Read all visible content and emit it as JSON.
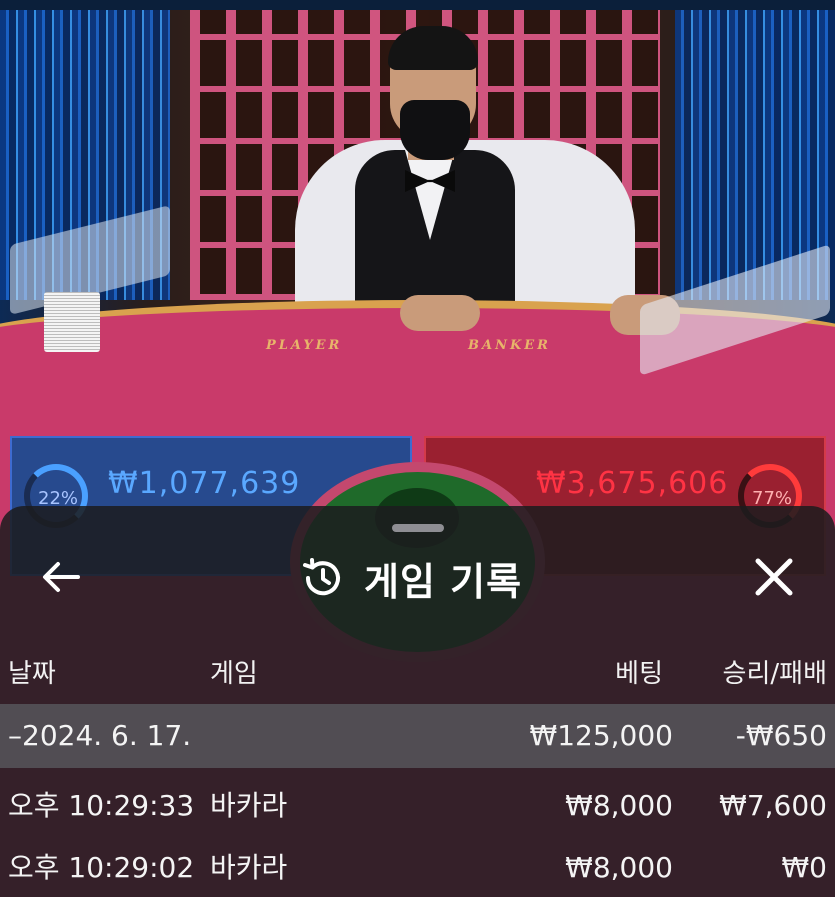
{
  "video": {
    "table_labels": [
      "PLAYER",
      "BANKER"
    ],
    "player": {
      "percent": "22%",
      "amount": "₩1,077,639"
    },
    "banker": {
      "percent": "77%",
      "amount": "₩3,675,606"
    }
  },
  "panel": {
    "title": "게임 기록",
    "icons": {
      "back": "arrow-left-icon",
      "history": "history-icon",
      "close": "close-icon"
    },
    "columns": {
      "date": "날짜",
      "game": "게임",
      "bet": "베팅",
      "win_loss": "승리/패배"
    },
    "group": {
      "date": "–2024. 6. 17.",
      "bet": "₩125,000",
      "win_loss": "-₩650"
    },
    "rows": [
      {
        "time": "오후 10:29:33",
        "game": "바카라",
        "bet": "₩8,000",
        "win_loss": "₩7,600"
      },
      {
        "time": "오후 10:29:02",
        "game": "바카라",
        "bet": "₩8,000",
        "win_loss": "₩0"
      }
    ]
  },
  "colors": {
    "panel_bg": "#1c1c1e",
    "group_row_bg": "#5a5a5f",
    "player_blue": "#5aa8ff",
    "banker_red": "#ff3344"
  }
}
